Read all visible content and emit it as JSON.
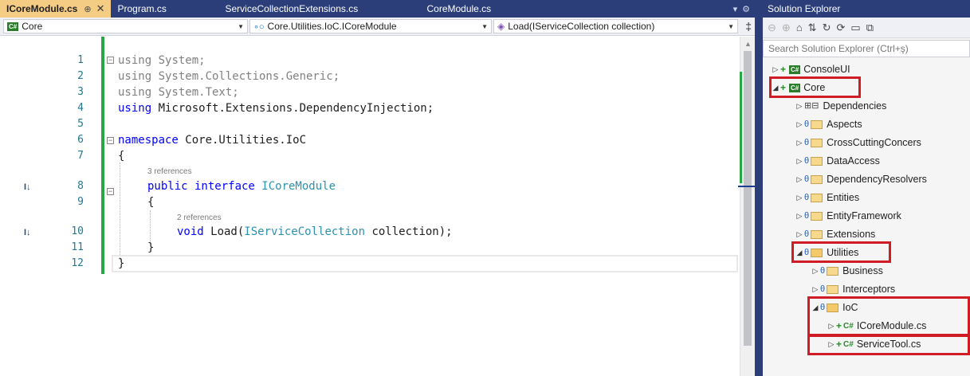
{
  "tabs": [
    {
      "label": "ICoreModule.cs",
      "pin": "⊕",
      "close": "✕",
      "active": true
    },
    {
      "label": "Program.cs"
    },
    {
      "label": "ServiceCollectionExtensions.cs"
    },
    {
      "label": "CoreModule.cs"
    }
  ],
  "tab_tools": {
    "dropdown": "▾",
    "settings": "⚙"
  },
  "nav": {
    "project_badge": "C#",
    "project": "Core",
    "type": "Core.Utilities.IoC.ICoreModule",
    "member": "Load(IServiceCollection collection)",
    "split": "‡"
  },
  "code": {
    "lines": [
      "1",
      "2",
      "3",
      "4",
      "5",
      "6",
      "7",
      "8",
      "9",
      "10",
      "11",
      "12"
    ],
    "l1_kw": "using",
    "l1_rest": " System;",
    "l2": "using System.Collections.Generic;",
    "l3": "using System.Text;",
    "l4_kw": "using",
    "l4_rest": " Microsoft.Extensions.DependencyInjection;",
    "l6_kw": "namespace",
    "l6_rest": " Core.Utilities.IoC",
    "l7": "{",
    "lens1": "3 references",
    "l8_kw": "public interface",
    "l8_type": " ICoreModule",
    "l9": "{",
    "lens2": "2 references",
    "l10_kw": "void",
    "l10_a": " Load(",
    "l10_type": "IServiceCollection",
    "l10_b": " collection);",
    "l11": "}",
    "l12": "}",
    "impl_icon": "I↓"
  },
  "solution_explorer": {
    "title": "Solution Explorer",
    "search_placeholder": "Search Solution Explorer (Ctrl+ş)",
    "toolbar": [
      "⊖",
      "⊕",
      "⌂",
      "⇅",
      "↻",
      "⟳",
      "▭",
      "⧉"
    ],
    "tree": [
      {
        "label": "ConsoleUI",
        "kind": "project"
      },
      {
        "label": "Core",
        "kind": "project"
      },
      {
        "label": "Dependencies",
        "kind": "deps"
      },
      {
        "label": "Aspects",
        "kind": "folder"
      },
      {
        "label": "CrossCuttingConcers",
        "kind": "folder"
      },
      {
        "label": "DataAccess",
        "kind": "folder"
      },
      {
        "label": "DependencyResolvers",
        "kind": "folder"
      },
      {
        "label": "Entities",
        "kind": "folder"
      },
      {
        "label": "EntityFramework",
        "kind": "folder"
      },
      {
        "label": "Extensions",
        "kind": "folder"
      },
      {
        "label": "Utilities",
        "kind": "folder-open"
      },
      {
        "label": "Business",
        "kind": "folder"
      },
      {
        "label": "Interceptors",
        "kind": "folder"
      },
      {
        "label": "IoC",
        "kind": "folder-open"
      },
      {
        "label": "ICoreModule.cs",
        "kind": "file"
      },
      {
        "label": "ServiceTool.cs",
        "kind": "file"
      }
    ],
    "highlight_color": "#d01c24"
  },
  "colors": {
    "accent": "#2b3e7a",
    "active_tab": "#f5cc84",
    "keyword": "#0000ff",
    "type": "#2b91af",
    "change_bar": "#28a745"
  }
}
